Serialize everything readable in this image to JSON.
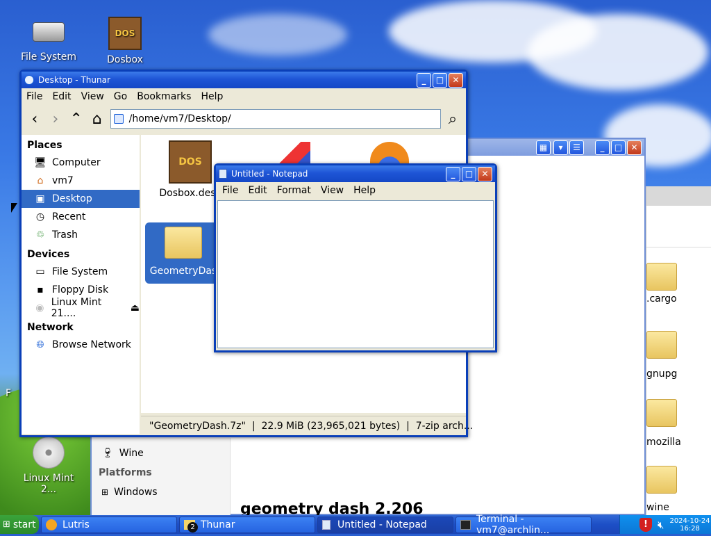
{
  "desktop": {
    "icons": [
      {
        "label": "File System"
      },
      {
        "label": "Dosbox"
      },
      {
        "label": "Linux Mint 2..."
      }
    ],
    "partial_label": "F"
  },
  "thunar": {
    "title": "Desktop - Thunar",
    "menu": [
      "File",
      "Edit",
      "View",
      "Go",
      "Bookmarks",
      "Help"
    ],
    "path": "/home/vm7/Desktop/",
    "sidebar": {
      "sections": [
        {
          "heading": "Places",
          "items": [
            {
              "label": "Computer",
              "icon": "computer-icon"
            },
            {
              "label": "vm7",
              "icon": "home-icon"
            },
            {
              "label": "Desktop",
              "icon": "desktop-icon",
              "selected": true
            },
            {
              "label": "Recent",
              "icon": "recent-icon"
            },
            {
              "label": "Trash",
              "icon": "trash-icon"
            }
          ]
        },
        {
          "heading": "Devices",
          "items": [
            {
              "label": "File System",
              "icon": "drive-icon"
            },
            {
              "label": "Floppy Disk",
              "icon": "floppy-icon"
            },
            {
              "label": "Linux Mint 21....",
              "icon": "disc-icon",
              "eject": true
            }
          ]
        },
        {
          "heading": "Network",
          "items": [
            {
              "label": "Browse Network",
              "icon": "network-icon"
            }
          ]
        }
      ]
    },
    "files": [
      {
        "label": "Dosbox.desk"
      },
      {
        "label": "GeometryDas",
        "selected": true
      }
    ],
    "status": "\"GeometryDash.7z\"  |  22.9 MiB (23,965,021 bytes)  |  7-zip arch..."
  },
  "notepad": {
    "title": "Untitled - Notepad",
    "menu": [
      "File",
      "Edit",
      "Format",
      "View",
      "Help"
    ],
    "text": ""
  },
  "background_window": {
    "folders": [
      ".cargo",
      "gnupg",
      "mozilla",
      "wine"
    ],
    "sidebar_items": [
      "Wine",
      "Platforms",
      "Windows"
    ],
    "heading": "geometry dash 2.206"
  },
  "taskbar": {
    "start_label": "start",
    "tasks": [
      {
        "label": "Lutris",
        "icon": "lutris-icon"
      },
      {
        "label": "Thunar",
        "icon": "folder-icon",
        "badge": "2"
      },
      {
        "label": "Untitled - Notepad",
        "icon": "notepad-icon",
        "active": true
      },
      {
        "label": "Terminal - vm7@archlin...",
        "icon": "terminal-icon"
      }
    ],
    "date": "2024-10-24",
    "time": "16:28"
  }
}
